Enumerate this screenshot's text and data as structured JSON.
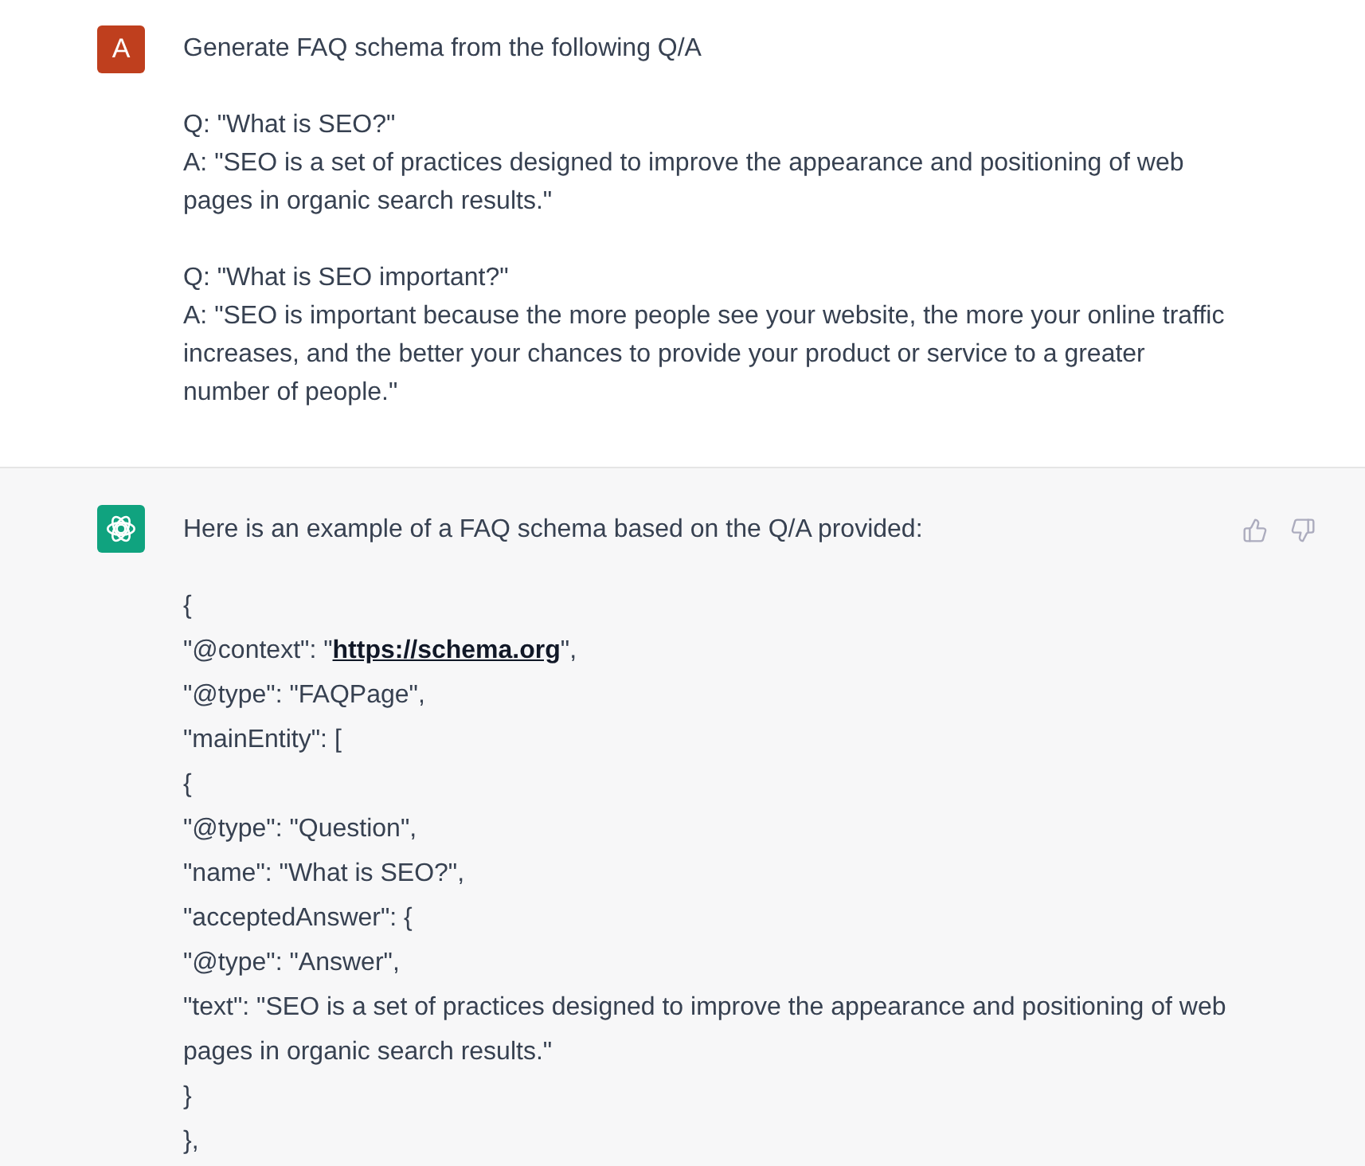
{
  "user_message": {
    "avatar": {
      "letter": "A"
    },
    "paragraphs": [
      [
        "Generate FAQ schema from the following Q/A"
      ],
      [
        "Q: \"What is SEO?\"",
        "A: \"SEO is a set of practices designed to improve the appearance and positioning of web pages in organic search results.\""
      ],
      [
        "Q: \"What is SEO important?\"",
        "A: \"SEO is important because the more people see your website, the more your online traffic increases, and the better your chances to provide your product or service to a greater number of people.\""
      ]
    ]
  },
  "assistant_message": {
    "intro": "Here is an example of a FAQ schema based on the Q/A provided:",
    "code_lines": [
      {
        "text": "{"
      },
      {
        "text": "\"@context\": \"",
        "link": "https://schema.org",
        "after": "\","
      },
      {
        "text": "\"@type\": \"FAQPage\","
      },
      {
        "text": "\"mainEntity\": ["
      },
      {
        "text": "{"
      },
      {
        "text": "\"@type\": \"Question\","
      },
      {
        "text": "\"name\": \"What is SEO?\","
      },
      {
        "text": "\"acceptedAnswer\": {"
      },
      {
        "text": "\"@type\": \"Answer\","
      },
      {
        "text": "\"text\": \"SEO is a set of practices designed to improve the appearance and positioning of web pages in organic search results.\""
      },
      {
        "text": "}"
      },
      {
        "text": "},"
      }
    ]
  }
}
